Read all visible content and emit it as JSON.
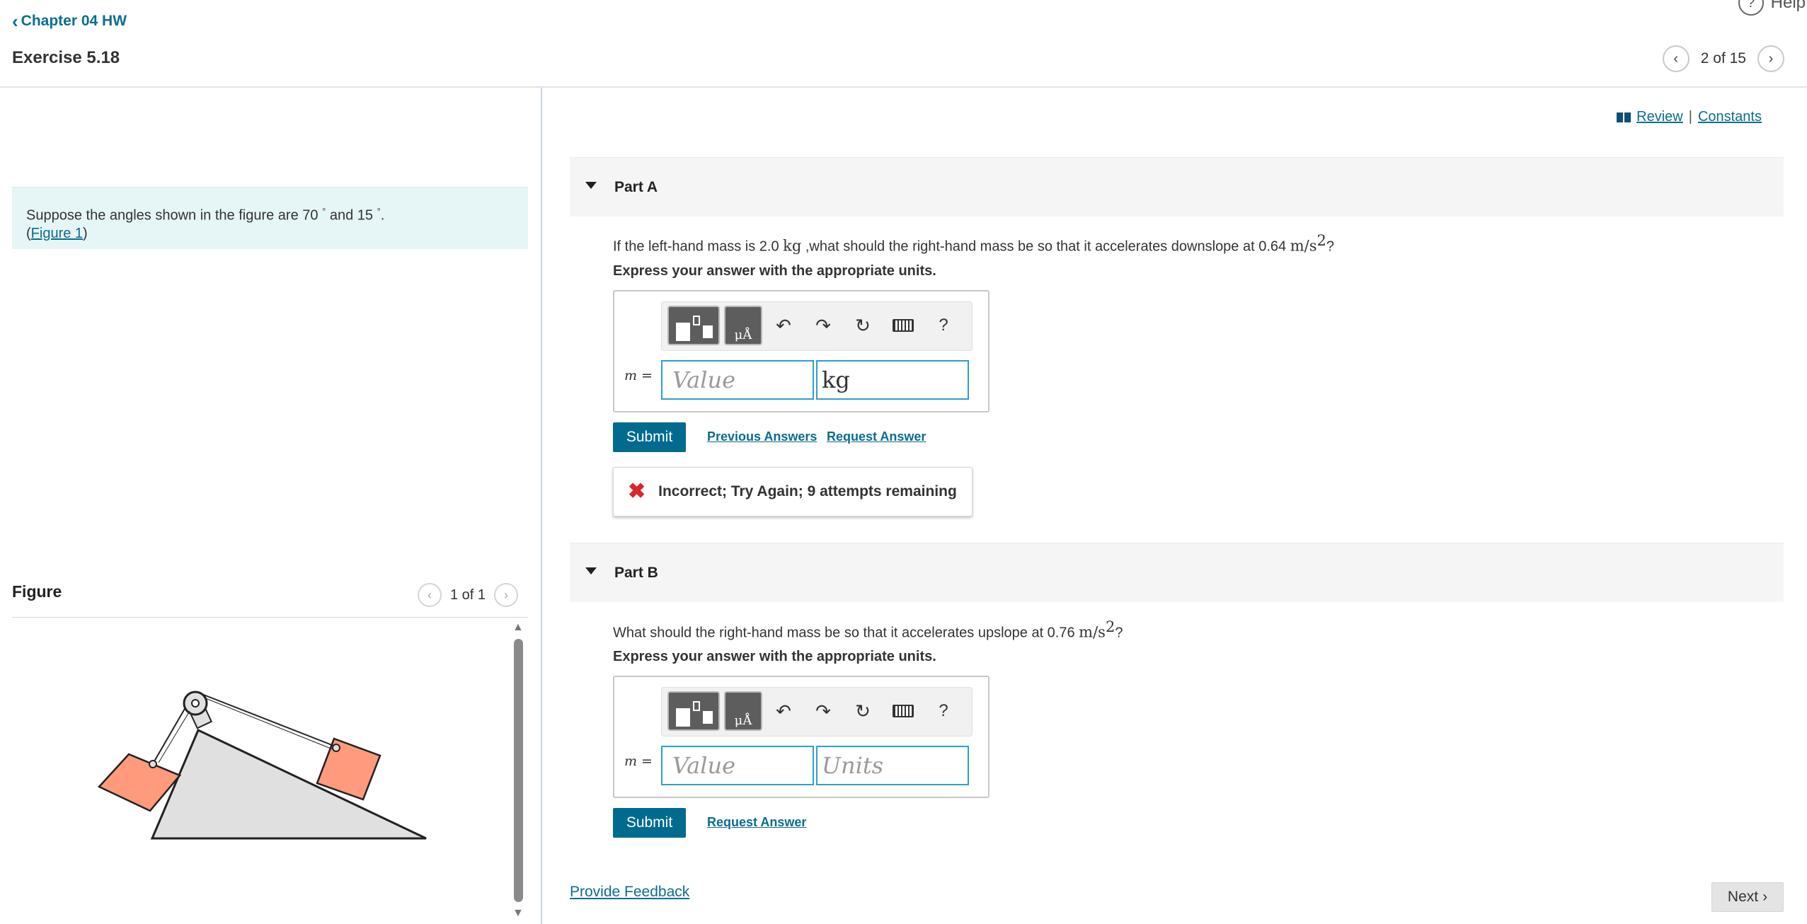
{
  "header": {
    "back_label": "Chapter 04 HW",
    "help_label": "Help",
    "exercise_title": "Exercise 5.18",
    "pager_text": "2 of 15"
  },
  "intro": {
    "text_before": "Suppose the angles shown in the figure are 70",
    "deg1": "°",
    "text_mid": " and 15",
    "deg2": "°",
    "text_end": ".",
    "open_paren": "(",
    "figure_link": "Figure 1",
    "close_paren": ")"
  },
  "figure": {
    "title": "Figure",
    "pager_text": "1 of 1"
  },
  "tools": {
    "review": "Review",
    "separator": "|",
    "constants": "Constants"
  },
  "part_a": {
    "label": "Part A",
    "q_before": "If the left-hand mass is 2.0 ",
    "q_unit1": "kg",
    "q_mid": " ,what should the right-hand mass be so that it accelerates downslope at 0.64 ",
    "q_unit2": "m/s",
    "q_exp": "2",
    "q_end": "?",
    "express": "Express your answer with the appropriate units.",
    "var_label": "m =",
    "value_placeholder": "Value",
    "unit_value": "kg",
    "submit": "Submit",
    "previous_answers": "Previous Answers",
    "request_answer": "Request Answer",
    "feedback": "Incorrect; Try Again; 9 attempts remaining"
  },
  "part_b": {
    "label": "Part B",
    "q_before": "What should the right-hand mass be so that it accelerates upslope at 0.76 ",
    "q_unit": "m/s",
    "q_exp": "2",
    "q_end": "?",
    "express": "Express your answer with the appropriate units.",
    "var_label": "m =",
    "value_placeholder": "Value",
    "units_placeholder": "Units",
    "submit": "Submit",
    "request_answer": "Request Answer"
  },
  "toolbar": {
    "units_button_label": "μÅ",
    "help_symbol": "?"
  },
  "footer": {
    "provide_feedback": "Provide Feedback",
    "next": "Next"
  },
  "colors": {
    "link": "#0b6d8f",
    "submit_bg": "#006b8f",
    "input_border": "#2e9fcf",
    "error_x": "#d8262c",
    "block_fill": "#ff9a7d",
    "intro_bg": "#e6f5f5"
  }
}
